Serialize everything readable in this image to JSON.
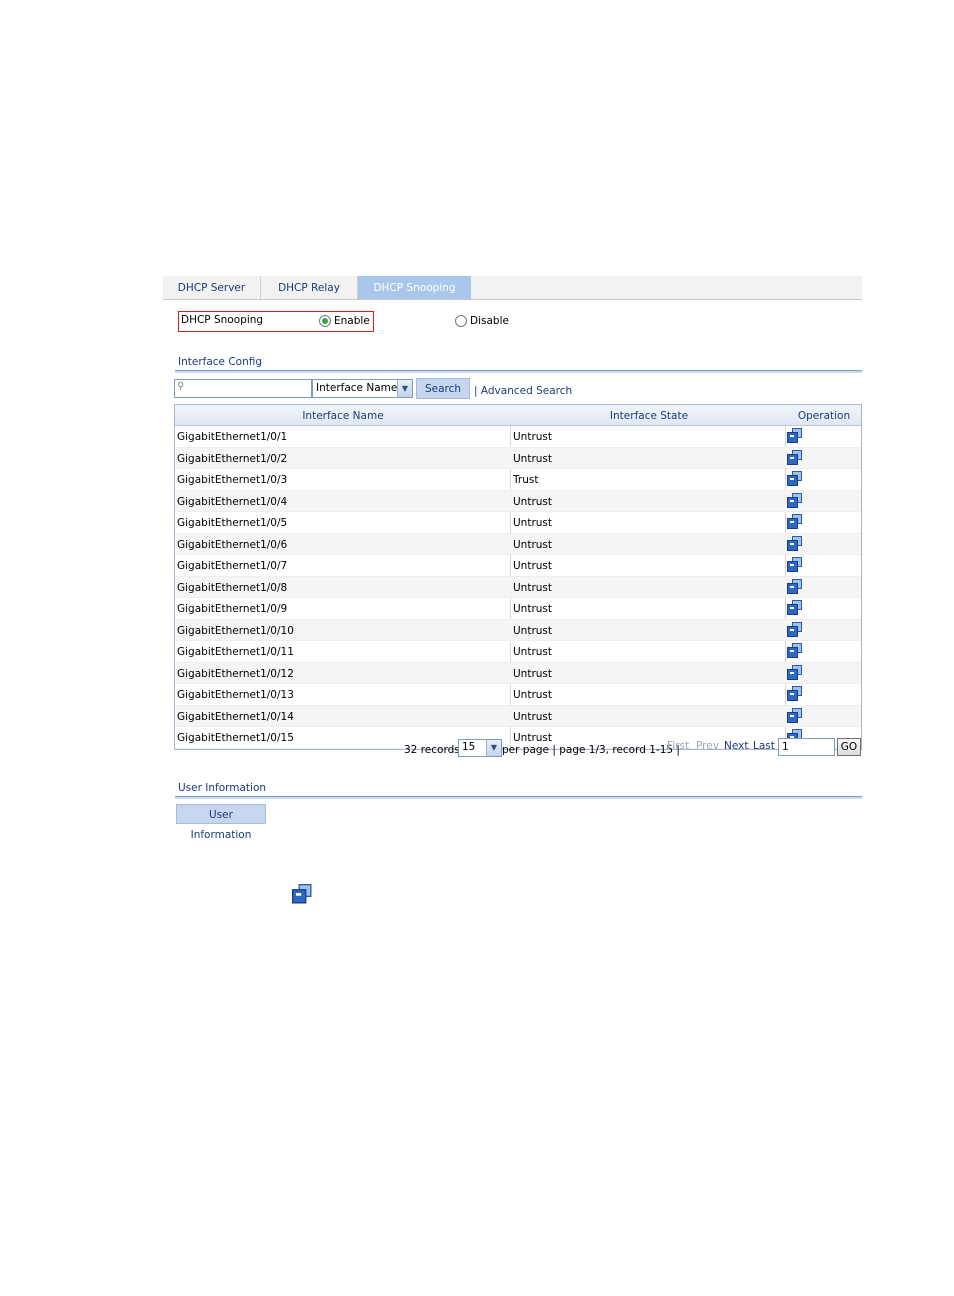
{
  "tabs": [
    {
      "label": "DHCP Server"
    },
    {
      "label": "DHCP Relay"
    },
    {
      "label": "DHCP Snooping"
    }
  ],
  "snooping": {
    "label": "DHCP Snooping",
    "enable_label": "Enable",
    "disable_label": "Disable",
    "selected": "Enable"
  },
  "interface_config": {
    "title": "Interface Config",
    "search": {
      "placeholder": "",
      "field": "Interface Name",
      "button": "Search",
      "advanced": "Advanced Search"
    },
    "table": {
      "headers": [
        "Interface Name",
        "Interface State",
        "Operation"
      ],
      "rows": [
        {
          "name": "GigabitEthernet1/0/1",
          "state": "Untrust"
        },
        {
          "name": "GigabitEthernet1/0/2",
          "state": "Untrust"
        },
        {
          "name": "GigabitEthernet1/0/3",
          "state": "Trust"
        },
        {
          "name": "GigabitEthernet1/0/4",
          "state": "Untrust"
        },
        {
          "name": "GigabitEthernet1/0/5",
          "state": "Untrust"
        },
        {
          "name": "GigabitEthernet1/0/6",
          "state": "Untrust"
        },
        {
          "name": "GigabitEthernet1/0/7",
          "state": "Untrust"
        },
        {
          "name": "GigabitEthernet1/0/8",
          "state": "Untrust"
        },
        {
          "name": "GigabitEthernet1/0/9",
          "state": "Untrust"
        },
        {
          "name": "GigabitEthernet1/0/10",
          "state": "Untrust"
        },
        {
          "name": "GigabitEthernet1/0/11",
          "state": "Untrust"
        },
        {
          "name": "GigabitEthernet1/0/12",
          "state": "Untrust"
        },
        {
          "name": "GigabitEthernet1/0/13",
          "state": "Untrust"
        },
        {
          "name": "GigabitEthernet1/0/14",
          "state": "Untrust"
        },
        {
          "name": "GigabitEthernet1/0/15",
          "state": "Untrust"
        }
      ],
      "operation_icon": "edit-icon"
    },
    "pager": {
      "records": "32 records,",
      "per_page_value": "15",
      "info": "per page | page 1/3, record 1-15 |",
      "first": "First",
      "prev": "Prev",
      "next": "Next",
      "last": "Last",
      "page_input": "1",
      "go": "GO"
    }
  },
  "user_information": {
    "title": "User Information",
    "button": "User Information"
  },
  "colors": {
    "link": "#1a3c7a",
    "tab_active": "#a9c7eb",
    "highlight_border": "#e01b1b"
  }
}
